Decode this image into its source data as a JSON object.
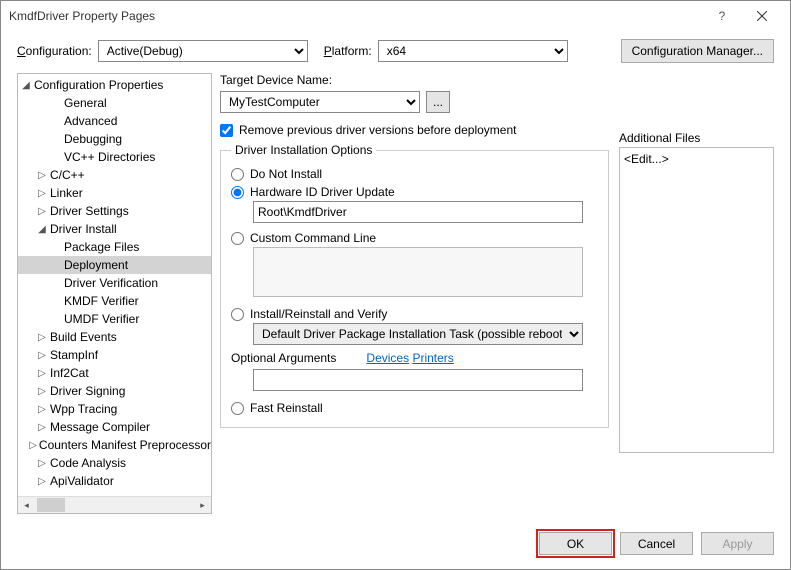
{
  "title": "KmdfDriver Property Pages",
  "topbar": {
    "configuration_label": "Configuration:",
    "configuration_value": "Active(Debug)",
    "platform_label": "Platform:",
    "platform_value": "x64",
    "config_manager": "Configuration Manager..."
  },
  "tree": {
    "root": "Configuration Properties",
    "items": [
      {
        "label": "General",
        "indent": 2,
        "arrow": ""
      },
      {
        "label": "Advanced",
        "indent": 2,
        "arrow": ""
      },
      {
        "label": "Debugging",
        "indent": 2,
        "arrow": ""
      },
      {
        "label": "VC++ Directories",
        "indent": 2,
        "arrow": ""
      },
      {
        "label": "C/C++",
        "indent": 1,
        "arrow": "▷"
      },
      {
        "label": "Linker",
        "indent": 1,
        "arrow": "▷"
      },
      {
        "label": "Driver Settings",
        "indent": 1,
        "arrow": "▷"
      },
      {
        "label": "Driver Install",
        "indent": 1,
        "arrow": "◢"
      },
      {
        "label": "Package Files",
        "indent": 2,
        "arrow": ""
      },
      {
        "label": "Deployment",
        "indent": 2,
        "arrow": "",
        "selected": true
      },
      {
        "label": "Driver Verification",
        "indent": 2,
        "arrow": ""
      },
      {
        "label": "KMDF Verifier",
        "indent": 2,
        "arrow": ""
      },
      {
        "label": "UMDF Verifier",
        "indent": 2,
        "arrow": ""
      },
      {
        "label": "Build Events",
        "indent": 1,
        "arrow": "▷"
      },
      {
        "label": "StampInf",
        "indent": 1,
        "arrow": "▷"
      },
      {
        "label": "Inf2Cat",
        "indent": 1,
        "arrow": "▷"
      },
      {
        "label": "Driver Signing",
        "indent": 1,
        "arrow": "▷"
      },
      {
        "label": "Wpp Tracing",
        "indent": 1,
        "arrow": "▷"
      },
      {
        "label": "Message Compiler",
        "indent": 1,
        "arrow": "▷"
      },
      {
        "label": "Counters Manifest Preprocessor",
        "indent": 1,
        "arrow": "▷"
      },
      {
        "label": "Code Analysis",
        "indent": 1,
        "arrow": "▷"
      },
      {
        "label": "ApiValidator",
        "indent": 1,
        "arrow": "▷"
      }
    ]
  },
  "main": {
    "target_label": "Target Device Name:",
    "target_value": "MyTestComputer",
    "browse": "...",
    "remove_label": "Remove previous driver versions before deployment",
    "install_legend": "Driver Installation Options",
    "opt_noinstall": "Do Not Install",
    "opt_hwid": "Hardware ID Driver Update",
    "hwid_value": "Root\\KmdfDriver",
    "opt_custom": "Custom Command Line",
    "opt_verify": "Install/Reinstall and Verify",
    "task_value": "Default Driver Package Installation Task (possible reboot)",
    "optargs_label": "Optional Arguments",
    "link_devices": "Devices",
    "link_printers": "Printers",
    "opt_fast": "Fast Reinstall",
    "addfiles_label": "Additional Files",
    "addfiles_value": "<Edit...>"
  },
  "footer": {
    "ok": "OK",
    "cancel": "Cancel",
    "apply": "Apply"
  }
}
